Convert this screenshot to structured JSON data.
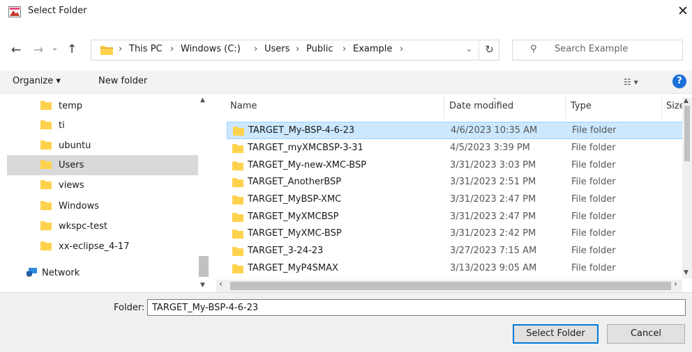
{
  "window": {
    "title": "Select Folder",
    "close_glyph": "✕"
  },
  "address": {
    "crumbs": [
      "This PC",
      "Windows (C:)",
      "Users",
      "Public",
      "Example"
    ],
    "separator": "›"
  },
  "search": {
    "placeholder": "Search Example"
  },
  "toolbar": {
    "organize_label": "Organize ▾",
    "new_folder_label": "New folder",
    "view_label": "☷ ▾",
    "help_label": "?"
  },
  "nav_pane": {
    "items": [
      {
        "label": "temp",
        "selected": false
      },
      {
        "label": "ti",
        "selected": false
      },
      {
        "label": "ubuntu",
        "selected": false
      },
      {
        "label": "Users",
        "selected": true
      },
      {
        "label": "views",
        "selected": false
      },
      {
        "label": "Windows",
        "selected": false
      },
      {
        "label": "wkspc-test",
        "selected": false
      },
      {
        "label": "xx-eclipse_4-17",
        "selected": false
      }
    ],
    "network_label": "Network"
  },
  "file_list": {
    "columns": {
      "name": "Name",
      "date": "Date modified",
      "type": "Type",
      "size": "Size"
    },
    "rows": [
      {
        "name": "TARGET_My-BSP-4-6-23",
        "date": "4/6/2023 10:35 AM",
        "type": "File folder",
        "selected": true
      },
      {
        "name": "TARGET_myXMCBSP-3-31",
        "date": "4/5/2023 3:39 PM",
        "type": "File folder",
        "selected": false
      },
      {
        "name": "TARGET_My-new-XMC-BSP",
        "date": "3/31/2023 3:03 PM",
        "type": "File folder",
        "selected": false
      },
      {
        "name": "TARGET_AnotherBSP",
        "date": "3/31/2023 2:51 PM",
        "type": "File folder",
        "selected": false
      },
      {
        "name": "TARGET_MyBSP-XMC",
        "date": "3/31/2023 2:47 PM",
        "type": "File folder",
        "selected": false
      },
      {
        "name": "TARGET_MyXMCBSP",
        "date": "3/31/2023 2:47 PM",
        "type": "File folder",
        "selected": false
      },
      {
        "name": "TARGET_MyXMC-BSP",
        "date": "3/31/2023 2:42 PM",
        "type": "File folder",
        "selected": false
      },
      {
        "name": "TARGET_3-24-23",
        "date": "3/27/2023 7:15 AM",
        "type": "File folder",
        "selected": false
      },
      {
        "name": "TARGET_MyP4SMAX",
        "date": "3/13/2023 9:05 AM",
        "type": "File folder",
        "selected": false
      }
    ]
  },
  "footer": {
    "folder_label": "Folder:",
    "folder_value": "TARGET_My-BSP-4-6-23",
    "select_button": "Select Folder",
    "cancel_button": "Cancel"
  },
  "colors": {
    "folder_yellow": "#ffd24d",
    "folder_shade": "#e8b23a",
    "selection_bg": "#cce8ff",
    "accent_blue": "#0078d7"
  },
  "icons": {
    "app": "select-folder-app-icon",
    "back": "arrow-left-icon",
    "forward": "arrow-right-icon",
    "up": "arrow-up-icon",
    "refresh": "refresh-icon",
    "search": "search-icon",
    "folder": "folder-icon",
    "network": "network-icon",
    "help": "help-icon"
  }
}
